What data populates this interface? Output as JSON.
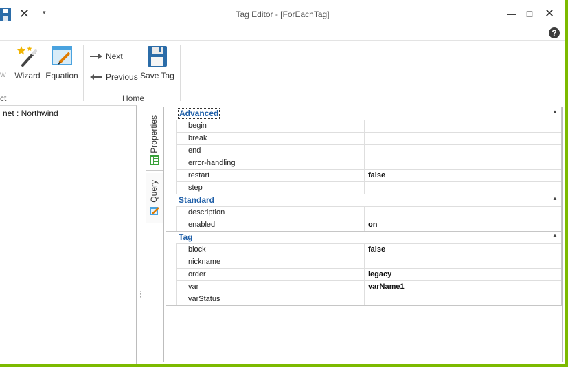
{
  "window": {
    "title": "Tag Editor - [ForEachTag]",
    "controls": {
      "minimize": "—",
      "maximize": "□",
      "close": "✕"
    },
    "help_label": "?"
  },
  "quick_access": {
    "close_glyph": "✕",
    "dropdown_glyph": "▾"
  },
  "ribbon": {
    "partial_button_label": "w",
    "partial_group_label": "ct",
    "wizard_label": "Wizard",
    "equation_label": "Equation",
    "next_label": "Next",
    "previous_label": "Previous",
    "save_tag_label": "Save Tag",
    "home_group_label": "Home"
  },
  "tree": {
    "node_label": "net : Northwind"
  },
  "side_tabs": {
    "properties_label": "Properties",
    "query_label": "Query"
  },
  "property_grid": {
    "categories": [
      {
        "name": "Advanced",
        "properties": [
          {
            "name": "begin",
            "value": ""
          },
          {
            "name": "break",
            "value": ""
          },
          {
            "name": "end",
            "value": ""
          },
          {
            "name": "error-handling",
            "value": ""
          },
          {
            "name": "restart",
            "value": "false"
          },
          {
            "name": "step",
            "value": ""
          }
        ]
      },
      {
        "name": "Standard",
        "properties": [
          {
            "name": "description",
            "value": ""
          },
          {
            "name": "enabled",
            "value": "on"
          }
        ]
      },
      {
        "name": "Tag",
        "properties": [
          {
            "name": "block",
            "value": "false"
          },
          {
            "name": "nickname",
            "value": ""
          },
          {
            "name": "order",
            "value": "legacy"
          },
          {
            "name": "var",
            "value": "varName1"
          },
          {
            "name": "varStatus",
            "value": ""
          }
        ]
      }
    ]
  },
  "colors": {
    "frame_border": "#7cba00",
    "category_text": "#1f5fa8",
    "wizard_star": "#f0b400",
    "equation_blue": "#4aa3df",
    "save_blue": "#2b6ca8"
  }
}
